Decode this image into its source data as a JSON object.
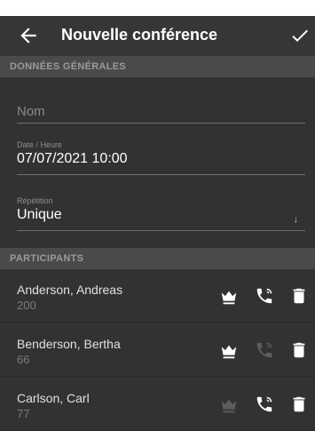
{
  "appbar": {
    "title": "Nouvelle conférence",
    "back_icon": "back-arrow-icon",
    "confirm_icon": "check-icon"
  },
  "general_section": {
    "title": "DONNÉES GÉNÉRALES",
    "name_field": {
      "placeholder": "Nom",
      "value": ""
    },
    "datetime_field": {
      "label": "Date / Heure",
      "value": "07/07/2021 10:00"
    },
    "repetition_field": {
      "label": "Répétition",
      "value": "Unique"
    }
  },
  "participants_section": {
    "title": "PARTICIPANTS",
    "participants": [
      {
        "name": "Anderson, Andreas",
        "number": "200",
        "moderator": true,
        "dial_out": true
      },
      {
        "name": "Benderson, Bertha",
        "number": "66",
        "moderator": true,
        "dial_out": false
      },
      {
        "name": "Carlson, Carl",
        "number": "77",
        "moderator": false,
        "dial_out": true
      }
    ]
  },
  "colors": {
    "background": "#323232",
    "appbar": "#363636",
    "section_header": "#4a4a4a",
    "icon_active": "#ffffff",
    "icon_inactive": "#5e5e5e"
  }
}
